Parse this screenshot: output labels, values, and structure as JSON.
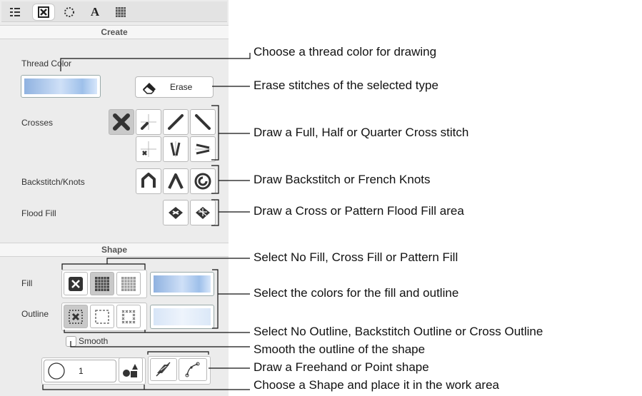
{
  "tabs": [
    "thread-list",
    "cross-stitch",
    "outline",
    "text",
    "fill-pattern"
  ],
  "create": {
    "header": "Create",
    "thread_color_label": "Thread Color",
    "erase_label": "Erase",
    "crosses_label": "Crosses",
    "backstitch_label": "Backstitch/Knots",
    "flood_fill_label": "Flood Fill"
  },
  "shape": {
    "header": "Shape",
    "fill_label": "Fill",
    "outline_label": "Outline",
    "smooth_label": "Smooth",
    "shape_count": "1"
  },
  "annotations": [
    "Choose a thread color for drawing",
    "Erase stitches of the selected type",
    "Draw a Full, Half or Quarter Cross stitch",
    "Draw Backstitch or French Knots",
    "Draw a Cross or Pattern Flood Fill area",
    "Select No Fill, Cross Fill or Pattern Fill",
    "Select the colors for the fill and outline",
    "Select No Outline, Backstitch Outline or Cross Outline",
    "Smooth the outline of the shape",
    "Draw a Freehand or Point shape",
    "Choose a Shape and place it in the work area"
  ],
  "colors": {
    "accent": "#9ec0ea",
    "panel": "#ececec"
  }
}
